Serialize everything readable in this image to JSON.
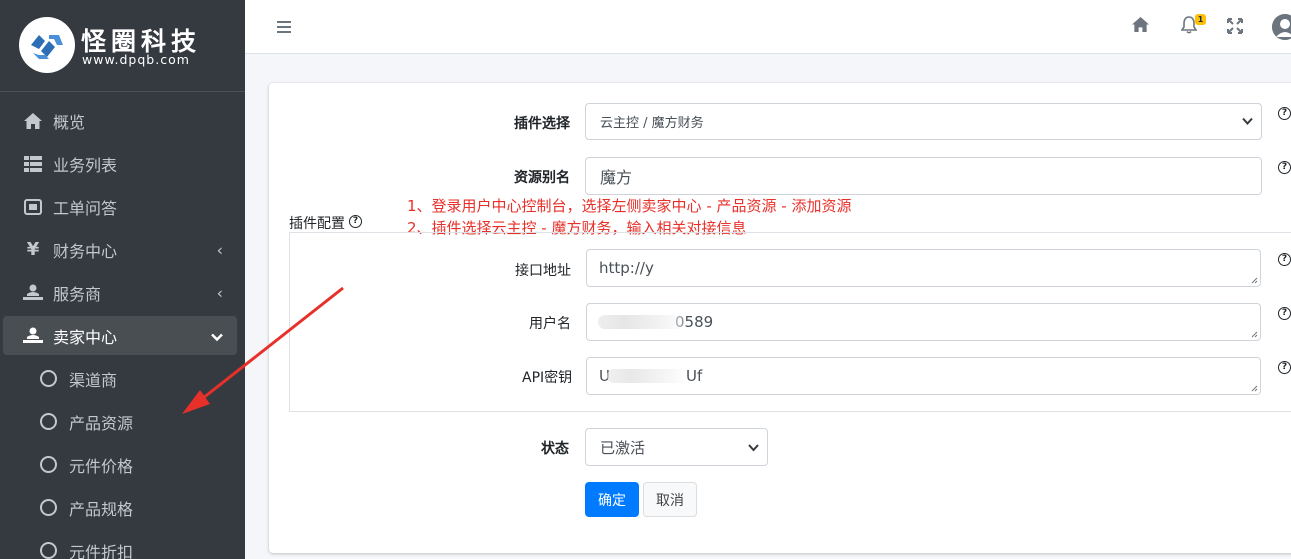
{
  "brand": {
    "title": "怪圈科技",
    "url": "www.dpqb.com"
  },
  "sidebar": {
    "items": [
      {
        "label": "概览",
        "icon": "home-icon"
      },
      {
        "label": "业务列表",
        "icon": "list-icon"
      },
      {
        "label": "工单问答",
        "icon": "ticket-icon"
      },
      {
        "label": "财务中心",
        "icon": "yen-icon"
      },
      {
        "label": "服务商",
        "icon": "user-desk-icon"
      },
      {
        "label": "卖家中心",
        "icon": "user-desk-icon"
      }
    ],
    "subitems": [
      "渠道商",
      "产品资源",
      "元件价格",
      "产品规格",
      "元件折扣"
    ]
  },
  "header": {
    "notification_count": "1"
  },
  "form": {
    "plugin_label": "插件选择",
    "plugin_value": "云主控 / 魔方财务",
    "alias_label": "资源别名",
    "alias_value": "魔方",
    "config_label": "插件配置",
    "api_url_label": "接口地址",
    "api_url_value": "http://y",
    "username_label": "用户名",
    "username_value": "0589",
    "api_key_label": "API密钥",
    "api_key_value_start": "U",
    "api_key_value_end": "Uf",
    "status_label": "状态",
    "status_value": "已激活",
    "confirm_label": "确定",
    "cancel_label": "取消"
  },
  "notes": {
    "line1": "1、登录用户中心控制台，选择左侧卖家中心 - 产品资源 - 添加资源",
    "line2": "2、插件选择云主控 - 魔方财务，输入相关对接信息"
  },
  "colors": {
    "sidebar_bg": "#343a40",
    "primary": "#007bff",
    "annotation": "#e8302a"
  }
}
